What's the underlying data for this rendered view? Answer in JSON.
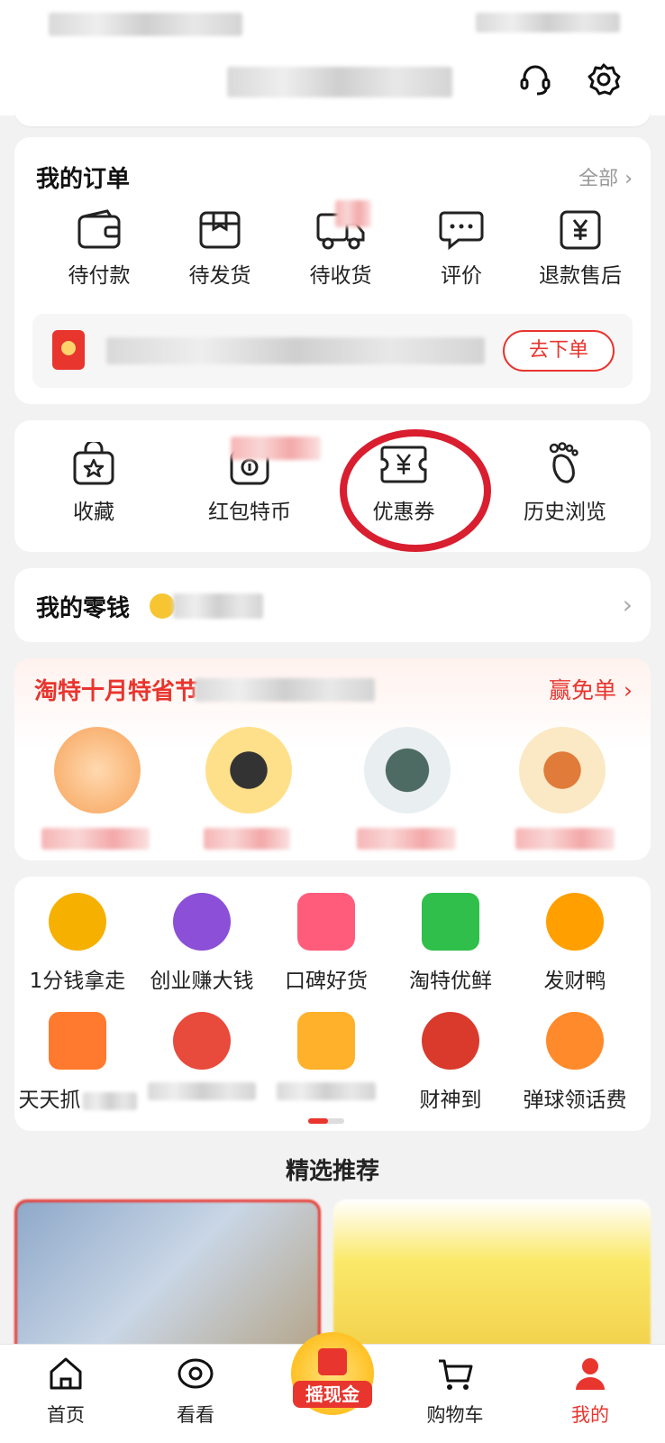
{
  "header": {
    "service_icon": "headset-icon",
    "settings_icon": "gear-icon"
  },
  "orders": {
    "title": "我的订单",
    "all_link": "全部",
    "items": [
      {
        "label": "待付款",
        "icon": "wallet-icon"
      },
      {
        "label": "待发货",
        "icon": "package-icon"
      },
      {
        "label": "待收货",
        "icon": "truck-icon"
      },
      {
        "label": "评价",
        "icon": "comment-icon"
      },
      {
        "label": "退款售后",
        "icon": "refund-icon"
      }
    ],
    "banner_button": "去下单"
  },
  "tools": {
    "items": [
      {
        "label": "收藏",
        "icon": "star-bag-icon"
      },
      {
        "label": "红包特币",
        "icon": "coin-icon"
      },
      {
        "label": "优惠券",
        "icon": "coupon-icon"
      },
      {
        "label": "历史浏览",
        "icon": "footprint-icon"
      }
    ]
  },
  "wallet": {
    "title": "我的零钱"
  },
  "promo": {
    "title": "淘特十月特省节",
    "link": "赢免单"
  },
  "grid": {
    "row1": [
      {
        "label": "1分钱拿走",
        "color": "#f5b000"
      },
      {
        "label": "创业赚大钱",
        "color": "#8b4fd8"
      },
      {
        "label": "口碑好货",
        "color": "#ff5c7c"
      },
      {
        "label": "淘特优鲜",
        "color": "#2fbf4a"
      },
      {
        "label": "发财鸭",
        "color": "#ffa000"
      }
    ],
    "row2": [
      {
        "label": "天天抓",
        "color": "#ff7a2e"
      },
      {
        "label": "",
        "color": "#e84a3c"
      },
      {
        "label": "",
        "color": "#ffb12b"
      },
      {
        "label": "财神到",
        "color": "#d93a2c"
      },
      {
        "label": "弹球领话费",
        "color": "#ff8a2b"
      }
    ]
  },
  "recommend": {
    "title": "精选推荐"
  },
  "tabbar": {
    "tabs": [
      {
        "label": "首页",
        "icon": "home-icon"
      },
      {
        "label": "看看",
        "icon": "eye-icon"
      },
      {
        "label": "摇现金",
        "icon": "red-envelope-icon"
      },
      {
        "label": "购物车",
        "icon": "cart-icon"
      },
      {
        "label": "我的",
        "icon": "profile-icon"
      }
    ]
  },
  "colors": {
    "accent": "#e8352e"
  }
}
